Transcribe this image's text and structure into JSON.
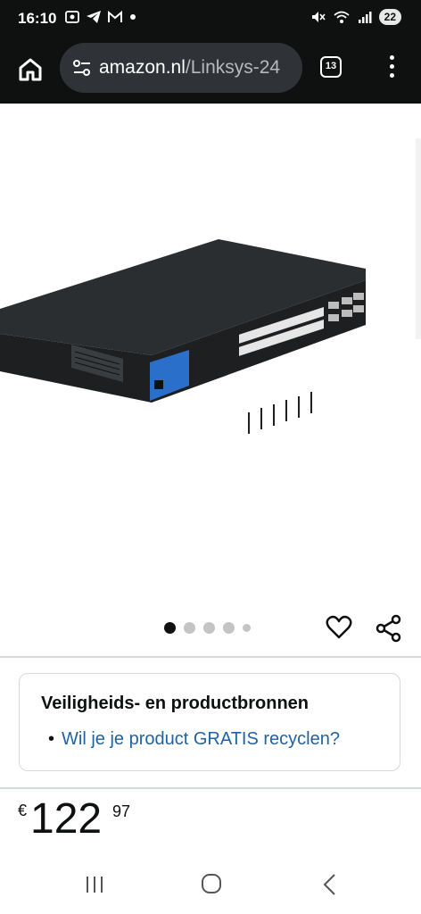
{
  "status_bar": {
    "time": "16:10",
    "battery": "22",
    "left_icons": [
      "screenshot-icon",
      "telegram-icon",
      "gmail-icon",
      "dot-icon"
    ],
    "right_icons": [
      "mute-icon",
      "wifi-icon",
      "signal-icon"
    ]
  },
  "browser": {
    "url_domain": "amazon.nl",
    "url_path": "/Linksys-24",
    "tab_count": "13",
    "bar_color": "#0f1111"
  },
  "gallery": {
    "image_count": 5,
    "active_index": 0,
    "image_description_icon": "network-switch-image"
  },
  "safety": {
    "title": "Veiligheids- en productbronnen",
    "link": "Wil je je product GRATIS recyclen?",
    "link_color": "#2162a1"
  },
  "price": {
    "symbol": "€",
    "whole": "122",
    "fraction": "97"
  },
  "nav": {
    "icons": [
      "recent-apps-icon",
      "home-icon",
      "back-icon"
    ]
  }
}
